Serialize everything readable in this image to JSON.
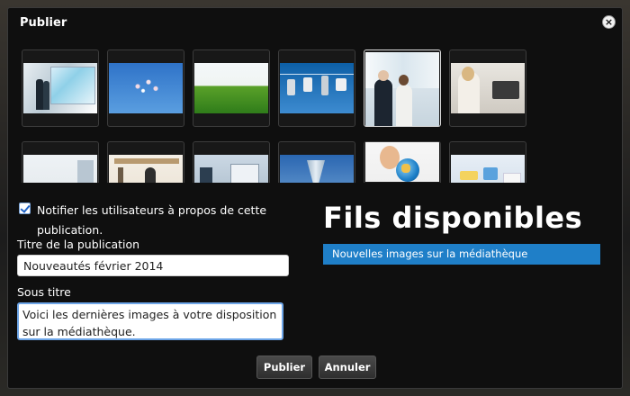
{
  "dialog": {
    "title": "Publier",
    "close_glyph": "×"
  },
  "gallery": {
    "row1": [
      {
        "subject": "business-presentation-photo"
      },
      {
        "subject": "sky-petals-photo"
      },
      {
        "subject": "grass-photo"
      },
      {
        "subject": "clothesline-devices-photo"
      },
      {
        "subject": "businesspeople-photo",
        "selected": true
      },
      {
        "subject": "office-woman-photo"
      }
    ],
    "row2": [
      {
        "subject": "office-photo"
      },
      {
        "subject": "meeting-room-photo"
      },
      {
        "subject": "laptop-office-photo"
      },
      {
        "subject": "architecture-photo"
      },
      {
        "subject": "child-globe-photo"
      },
      {
        "subject": "medical-supplies-photo"
      }
    ]
  },
  "form": {
    "notify_checked": true,
    "notify_label": "Notifier les utilisateurs à propos de cette publication.",
    "title_label": "Titre de la publication",
    "title_value": "Nouveautés février 2014",
    "subtitle_label": "Sous titre",
    "subtitle_value": "Voici les dernières images à votre disposition sur la médiathèque."
  },
  "feeds": {
    "heading": "Fils disponibles",
    "items": [
      {
        "label": "Nouvelles images sur la médiathèque",
        "selected": true
      }
    ]
  },
  "actions": {
    "publish_label": "Publier",
    "cancel_label": "Annuler"
  }
}
